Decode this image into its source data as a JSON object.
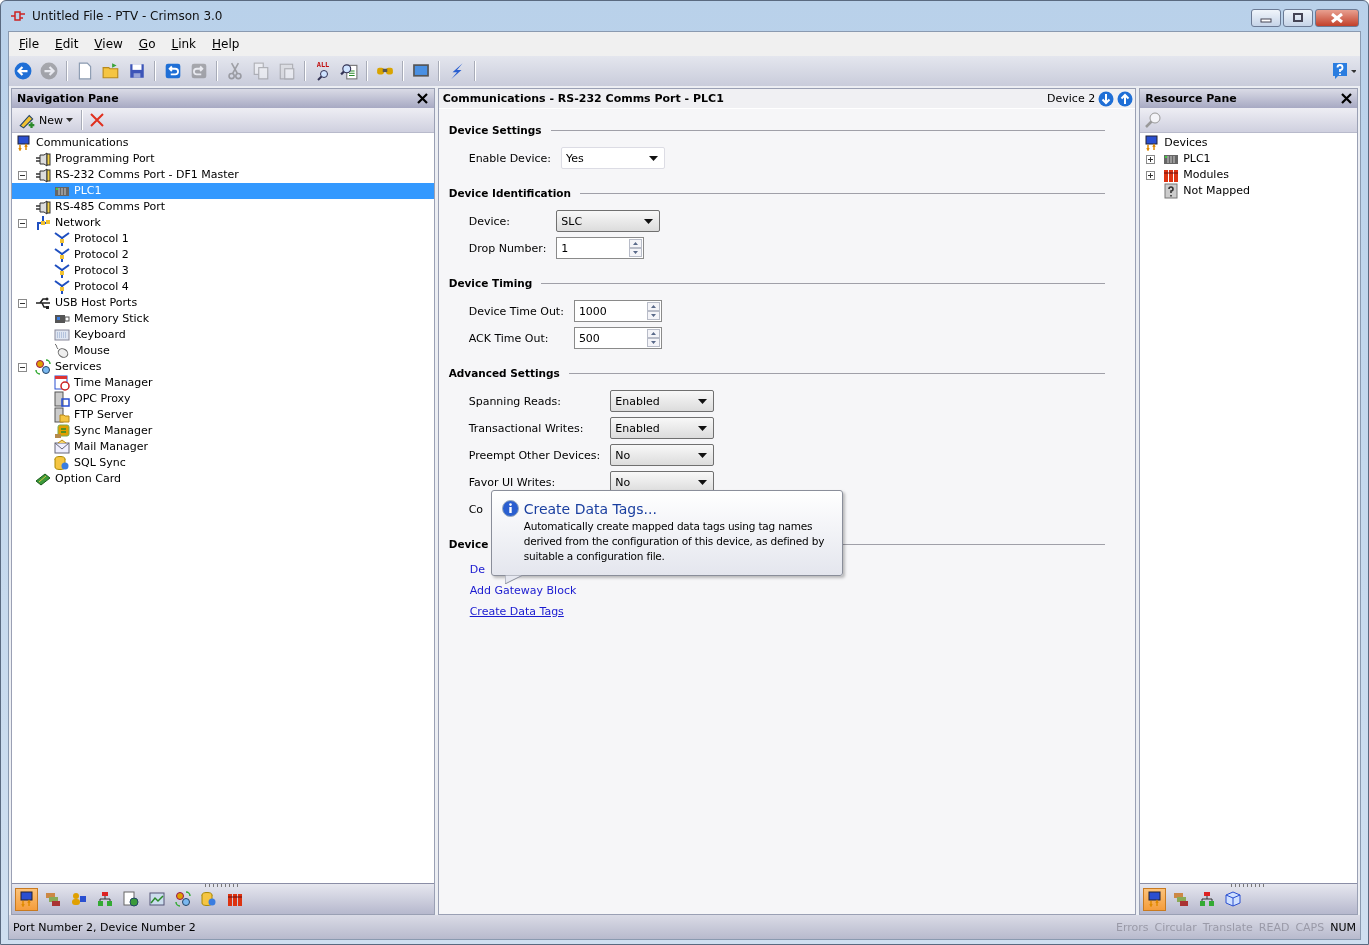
{
  "window": {
    "title": "Untitled File - PTV - Crimson 3.0"
  },
  "menu": [
    "File",
    "Edit",
    "View",
    "Go",
    "Link",
    "Help"
  ],
  "toolbar": [
    {
      "kind": "back",
      "disabled": false
    },
    {
      "kind": "forward",
      "disabled": true
    },
    {
      "kind": "separator"
    },
    {
      "kind": "new",
      "disabled": false
    },
    {
      "kind": "open",
      "disabled": false
    },
    {
      "kind": "save",
      "disabled": false
    },
    {
      "kind": "separator"
    },
    {
      "kind": "undo",
      "disabled": false
    },
    {
      "kind": "redo",
      "disabled": true
    },
    {
      "kind": "separator"
    },
    {
      "kind": "cut",
      "disabled": true
    },
    {
      "kind": "copy",
      "disabled": true
    },
    {
      "kind": "paste",
      "disabled": true
    },
    {
      "kind": "separator"
    },
    {
      "kind": "find-all",
      "label": "ALL",
      "disabled": false
    },
    {
      "kind": "find",
      "disabled": false
    },
    {
      "kind": "separator"
    },
    {
      "kind": "binoculars",
      "disabled": false
    },
    {
      "kind": "separator"
    },
    {
      "kind": "monitor",
      "disabled": false
    },
    {
      "kind": "separator"
    },
    {
      "kind": "lightning",
      "disabled": false
    },
    {
      "kind": "separator"
    }
  ],
  "navigation_pane": {
    "title": "Navigation Pane",
    "new_button": "New",
    "tree": [
      {
        "label": "Communications",
        "kind": "comms",
        "selected": false,
        "children": [
          {
            "label": "Programming Port",
            "kind": "port",
            "selected": false
          },
          {
            "label": "RS-232 Comms Port - DF1 Master",
            "kind": "port",
            "selected": false,
            "expanded": true,
            "children": [
              {
                "label": "PLC1",
                "kind": "plc",
                "selected": true
              }
            ]
          },
          {
            "label": "RS-485 Comms Port",
            "kind": "port",
            "selected": false
          },
          {
            "label": "Network",
            "kind": "network",
            "selected": false,
            "expanded": true,
            "children": [
              {
                "label": "Protocol 1",
                "kind": "protocol",
                "selected": false
              },
              {
                "label": "Protocol 2",
                "kind": "protocol",
                "selected": false
              },
              {
                "label": "Protocol 3",
                "kind": "protocol",
                "selected": false
              },
              {
                "label": "Protocol 4",
                "kind": "protocol",
                "selected": false
              }
            ]
          },
          {
            "label": "USB Host Ports",
            "kind": "usb",
            "selected": false,
            "expanded": true,
            "children": [
              {
                "label": "Memory Stick",
                "kind": "memory",
                "selected": false
              },
              {
                "label": "Keyboard",
                "kind": "keyboard",
                "selected": false
              },
              {
                "label": "Mouse",
                "kind": "mouse",
                "selected": false
              }
            ]
          },
          {
            "label": "Services",
            "kind": "services",
            "selected": false,
            "expanded": true,
            "children": [
              {
                "label": "Time Manager",
                "kind": "clock",
                "selected": false
              },
              {
                "label": "OPC Proxy",
                "kind": "opc",
                "selected": false
              },
              {
                "label": "FTP Server",
                "kind": "ftp",
                "selected": false
              },
              {
                "label": "Sync Manager",
                "kind": "sync",
                "selected": false
              },
              {
                "label": "Mail Manager",
                "kind": "mail",
                "selected": false
              },
              {
                "label": "SQL Sync",
                "kind": "sql",
                "selected": false
              }
            ]
          },
          {
            "label": "Option Card",
            "kind": "card",
            "selected": false
          }
        ]
      }
    ],
    "bottom_buttons": [
      {
        "kind": "comms",
        "selected": true
      },
      {
        "kind": "stack",
        "selected": false
      },
      {
        "kind": "people",
        "selected": false
      },
      {
        "kind": "tree",
        "selected": false
      },
      {
        "kind": "globe",
        "selected": false
      },
      {
        "kind": "chart",
        "selected": false
      },
      {
        "kind": "services",
        "selected": false
      },
      {
        "kind": "sql",
        "selected": false
      },
      {
        "kind": "modules",
        "selected": false
      }
    ]
  },
  "editor": {
    "title": "Communications - RS-232 Comms Port - PLC1",
    "device_label": "Device 2",
    "sections": [
      {
        "heading": "Device Settings",
        "rows": [
          {
            "label": "Enable Device:",
            "kind": "select",
            "value": "Yes"
          }
        ]
      },
      {
        "heading": "Device Identification",
        "rows": [
          {
            "label": "Device:",
            "kind": "select",
            "value": "SLC"
          },
          {
            "label": "Drop Number:",
            "kind": "spin",
            "value": "1"
          }
        ]
      },
      {
        "heading": "Device Timing",
        "rows": [
          {
            "label": "Device Time Out:",
            "kind": "spin",
            "value": "1000"
          },
          {
            "label": "ACK Time Out:",
            "kind": "spin",
            "value": "500"
          }
        ]
      },
      {
        "heading": "Advanced Settings",
        "rows": [
          {
            "label": "Spanning Reads:",
            "kind": "select",
            "value": "Enabled"
          },
          {
            "label": "Transactional Writes:",
            "kind": "select",
            "value": "Enabled"
          },
          {
            "label": "Preempt Other Devices:",
            "kind": "select",
            "value": "No"
          },
          {
            "label": "Favor UI Writes:",
            "kind": "select",
            "value": "No"
          },
          {
            "label": "Co",
            "kind": "label"
          }
        ]
      },
      {
        "heading": "Device",
        "links": [
          {
            "label": "De",
            "hovered": false
          },
          {
            "label": "Add Gateway Block",
            "hovered": false
          },
          {
            "label": "Create Data Tags",
            "hovered": true
          }
        ]
      }
    ],
    "tooltip": {
      "title": "Create Data Tags...",
      "text": "Automatically create mapped data tags using tag names derived from the configuration of this device, as defined by suitable a configuration file."
    }
  },
  "resource_pane": {
    "title": "Resource Pane",
    "tree": [
      {
        "label": "Devices",
        "kind": "comms",
        "selected": false,
        "children": [
          {
            "label": "PLC1",
            "kind": "plc",
            "selected": false,
            "expanded": false
          },
          {
            "label": "Modules",
            "kind": "modules",
            "selected": false,
            "expanded": false
          },
          {
            "label": "Not Mapped",
            "kind": "unknown",
            "selected": false
          }
        ]
      }
    ],
    "bottom_buttons": [
      {
        "kind": "comms",
        "selected": true
      },
      {
        "kind": "stack",
        "selected": false
      },
      {
        "kind": "tree",
        "selected": false
      },
      {
        "kind": "cube",
        "selected": false
      }
    ]
  },
  "status_bar": {
    "text": "Port Number 2, Device Number 2",
    "indicators": [
      {
        "label": "Errors",
        "on": false
      },
      {
        "label": "Circular",
        "on": false
      },
      {
        "label": "Translate",
        "on": false
      },
      {
        "label": "READ",
        "on": false
      },
      {
        "label": "CAPS",
        "on": false
      },
      {
        "label": "NUM",
        "on": true
      }
    ]
  }
}
